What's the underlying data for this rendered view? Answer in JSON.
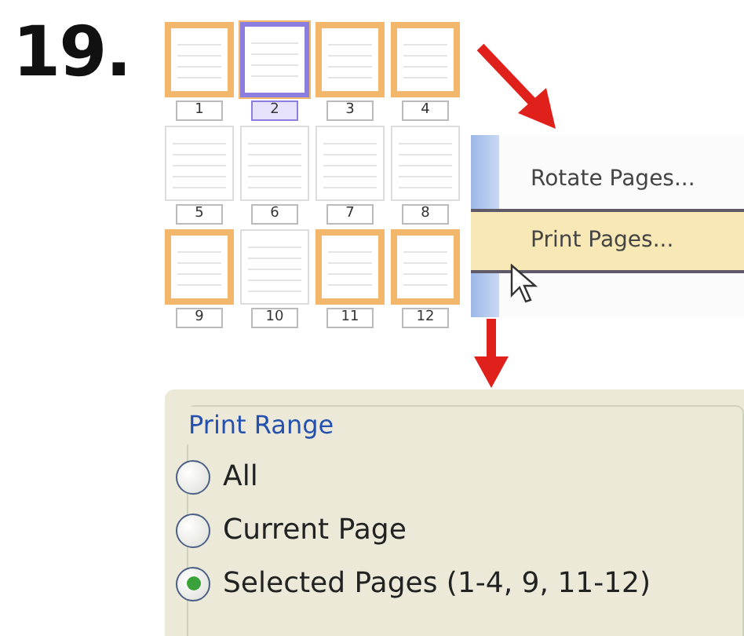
{
  "step_number": "19.",
  "thumbnails": [
    {
      "label": "1",
      "selected": true,
      "current": false
    },
    {
      "label": "2",
      "selected": true,
      "current": true
    },
    {
      "label": "3",
      "selected": true,
      "current": false
    },
    {
      "label": "4",
      "selected": true,
      "current": false
    },
    {
      "label": "5",
      "selected": false,
      "current": false
    },
    {
      "label": "6",
      "selected": false,
      "current": false
    },
    {
      "label": "7",
      "selected": false,
      "current": false
    },
    {
      "label": "8",
      "selected": false,
      "current": false
    },
    {
      "label": "9",
      "selected": true,
      "current": false
    },
    {
      "label": "10",
      "selected": false,
      "current": false
    },
    {
      "label": "11",
      "selected": true,
      "current": false
    },
    {
      "label": "12",
      "selected": true,
      "current": false
    }
  ],
  "context_menu": {
    "items": [
      {
        "label": "Rotate Pages...",
        "highlighted": false
      },
      {
        "label": "Print Pages...",
        "highlighted": true
      }
    ]
  },
  "print_range": {
    "title": "Print Range",
    "options": [
      {
        "label": "All",
        "selected": false
      },
      {
        "label": "Current Page",
        "selected": false
      },
      {
        "label": "Selected Pages (1-4, 9, 11-12)",
        "selected": true
      }
    ]
  }
}
